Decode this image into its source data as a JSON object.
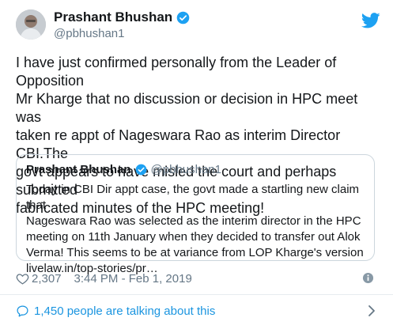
{
  "tweet": {
    "author": {
      "name": "Prashant Bhushan",
      "handle": "@pbhushan1",
      "verified": true
    },
    "text": "I have just confirmed personally from the Leader of Opposition\nMr Kharge that no discussion or decision in HPC meet was\ntaken re appt of Nageswara Rao as interim Director CBI.The\ngovt appears to have misled the court and perhaps submitted\nfabricated minutes of the HPC meeting!",
    "quoted": {
      "name": "Prashant Bhushan",
      "handle": "@pbhushan1",
      "text": "Today in CBI Dir appt case, the govt made a startling new claim that\nNageswara Rao was selected as the interim director in the HPC\nmeeting on 11th January when they decided to transfer out Alok\nVerma! This seems to be at variance from LOP Kharge's version\nlivelaw.in/top-stories/pr…"
    },
    "likes": "2,307",
    "timestamp": "3:44 PM - Feb 1, 2019",
    "talking": "1,450 people are talking about this"
  },
  "colors": {
    "accent": "#1da1f2",
    "link": "#1b95e0",
    "secondary_text": "#657786",
    "border": "#ccd6dd"
  },
  "icons": [
    "verified-badge-icon",
    "twitter-bird-icon",
    "heart-icon",
    "info-icon",
    "comment-bubble-icon",
    "chevron-right-icon"
  ]
}
